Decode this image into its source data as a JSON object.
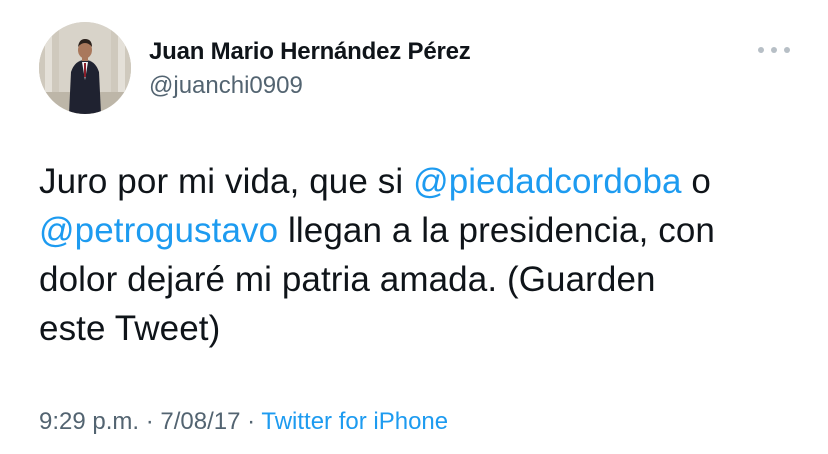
{
  "author": {
    "display_name": "Juan Mario Hernández Pérez",
    "handle": "@juanchi0909",
    "avatar_icon": "profile-photo-man-in-suit"
  },
  "more_icon": "more-horizontal-icon",
  "tweet": {
    "line1_text": "Juro por mi vida, que si ",
    "line1_mention": "@piedadcordoba",
    "line1_end": " o",
    "line2_mention": "@petrogustavo",
    "line2_text": " llegan a la presidencia, con",
    "line3_text": "dolor dejaré mi patria amada. (Guarden",
    "line4_text": "este Tweet)"
  },
  "meta": {
    "time": "9:29 p.m.",
    "sep1": " · ",
    "date": "7/08/17",
    "sep2": " · ",
    "source": "Twitter for iPhone"
  },
  "colors": {
    "mention": "#1d9bf0",
    "secondary_text": "#536471",
    "primary_text": "#0f1419"
  }
}
